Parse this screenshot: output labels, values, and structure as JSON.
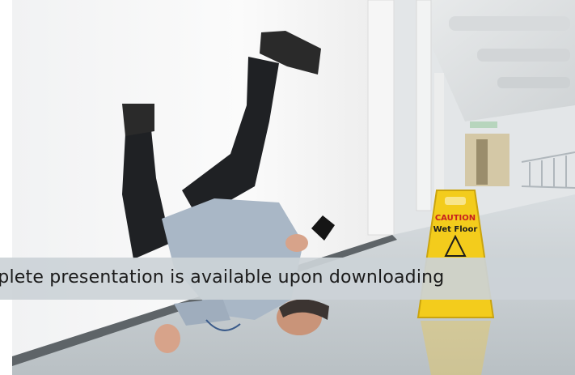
{
  "sign": {
    "line1": "CAUTION",
    "line2": "Wet Floor"
  },
  "overlay": {
    "text": "omplete presentation is available upon downloading"
  },
  "colors": {
    "sign_yellow": "#f3cc1c",
    "sign_red": "#c8201e",
    "banner": "#ccd2d7",
    "shirt": "#a9b7c6",
    "trousers": "#1f2124"
  }
}
